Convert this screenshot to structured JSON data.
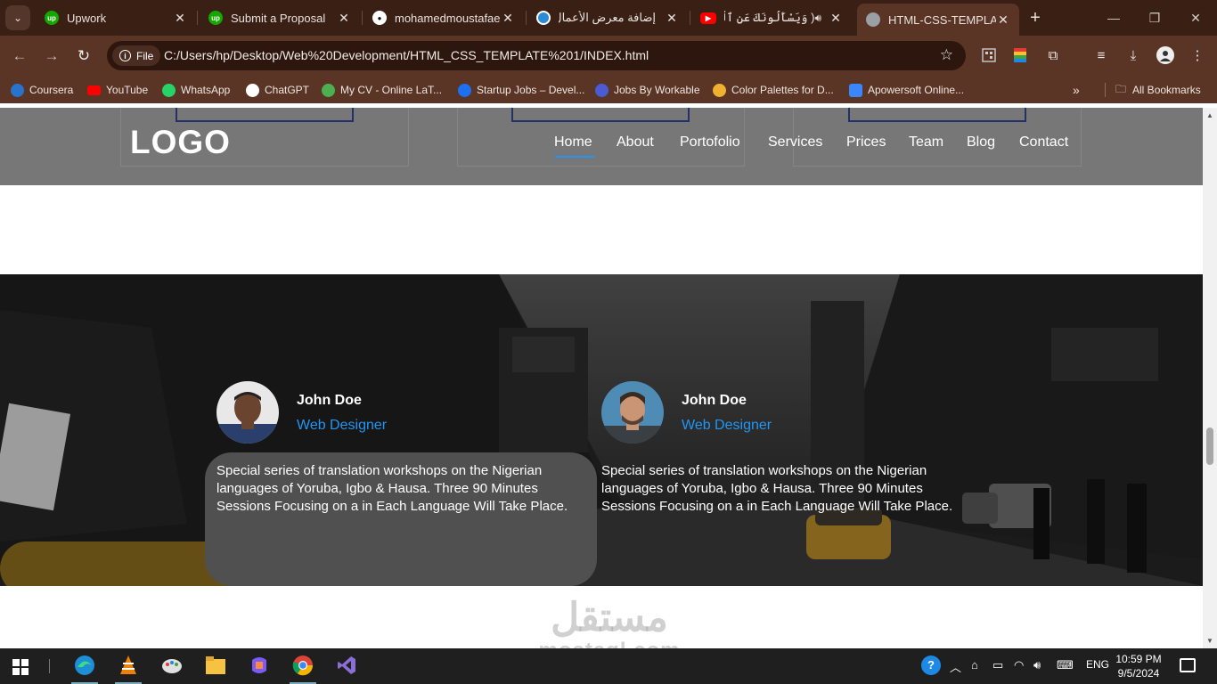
{
  "browser": {
    "tabs": [
      {
        "label": "Upwork",
        "icon": "upwork-icon",
        "color": "#14a800"
      },
      {
        "label": "Submit a Proposal",
        "icon": "upwork-icon",
        "color": "#14a800"
      },
      {
        "label": "mohamedmoustafaeg",
        "icon": "github-icon",
        "color": "#ffffff"
      },
      {
        "label": "إضافة معرض الأعمال |",
        "icon": "mostaql-icon",
        "color": "#2c8bd6"
      },
      {
        "label": "( وَيَسْأَلُونَكَ عَنِ ٱلْجِ",
        "icon": "youtube-icon",
        "color": "#ff0000"
      },
      {
        "label": "HTML-CSS-TEMPLATE",
        "icon": "globe-icon",
        "color": "#9aa0a6"
      }
    ],
    "site_chip": "File",
    "url": "C:/Users/hp/Desktop/Web%20Development/HTML_CSS_TEMPLATE%201/INDEX.html",
    "bookmarks": [
      {
        "label": "Coursera",
        "color": "#2a73cc"
      },
      {
        "label": "YouTube",
        "color": "#ff0000"
      },
      {
        "label": "WhatsApp",
        "color": "#25d366"
      },
      {
        "label": "ChatGPT",
        "color": "#ffffff"
      },
      {
        "label": "My CV - Online LaT...",
        "color": "#4caf50"
      },
      {
        "label": "Startup Jobs – Devel...",
        "color": "#1e6ff2"
      },
      {
        "label": "Jobs By Workable",
        "color": "#4b5bd4"
      },
      {
        "label": "Color Palettes for D...",
        "color": "#f0b030"
      },
      {
        "label": "Apowersoft Online...",
        "color": "#3a86ff"
      }
    ],
    "all_bookmarks": "All Bookmarks"
  },
  "page": {
    "logo": "LOGO",
    "nav": [
      "Home",
      "About",
      "Portofolio",
      "Services",
      "Prices",
      "Team",
      "Blog",
      "Contact"
    ],
    "testimonials": [
      {
        "name": "John Doe",
        "role": "Web Designer",
        "text": "Special series of translation workshops on the Nigerian languages of Yoruba, Igbo & Hausa. Three 90 Minutes Sessions Focusing on a in Each Language Will Take Place."
      },
      {
        "name": "John Doe",
        "role": "Web Designer",
        "text": "Special series of translation workshops on the Nigerian languages of Yoruba, Igbo & Hausa. Three 90 Minutes Sessions Focusing on a in Each Language Will Take Place."
      }
    ],
    "accent_color": "#2196f3",
    "watermark": {
      "arabic": "مستقل",
      "latin": "mostaql.com"
    }
  },
  "taskbar": {
    "apps": [
      "edge-icon",
      "vlc-icon",
      "paint-icon",
      "file-explorer-icon",
      "copilot-icon",
      "chrome-icon",
      "visual-studio-icon"
    ],
    "language": "ENG",
    "time": "10:59 PM",
    "date": "9/5/2024"
  }
}
